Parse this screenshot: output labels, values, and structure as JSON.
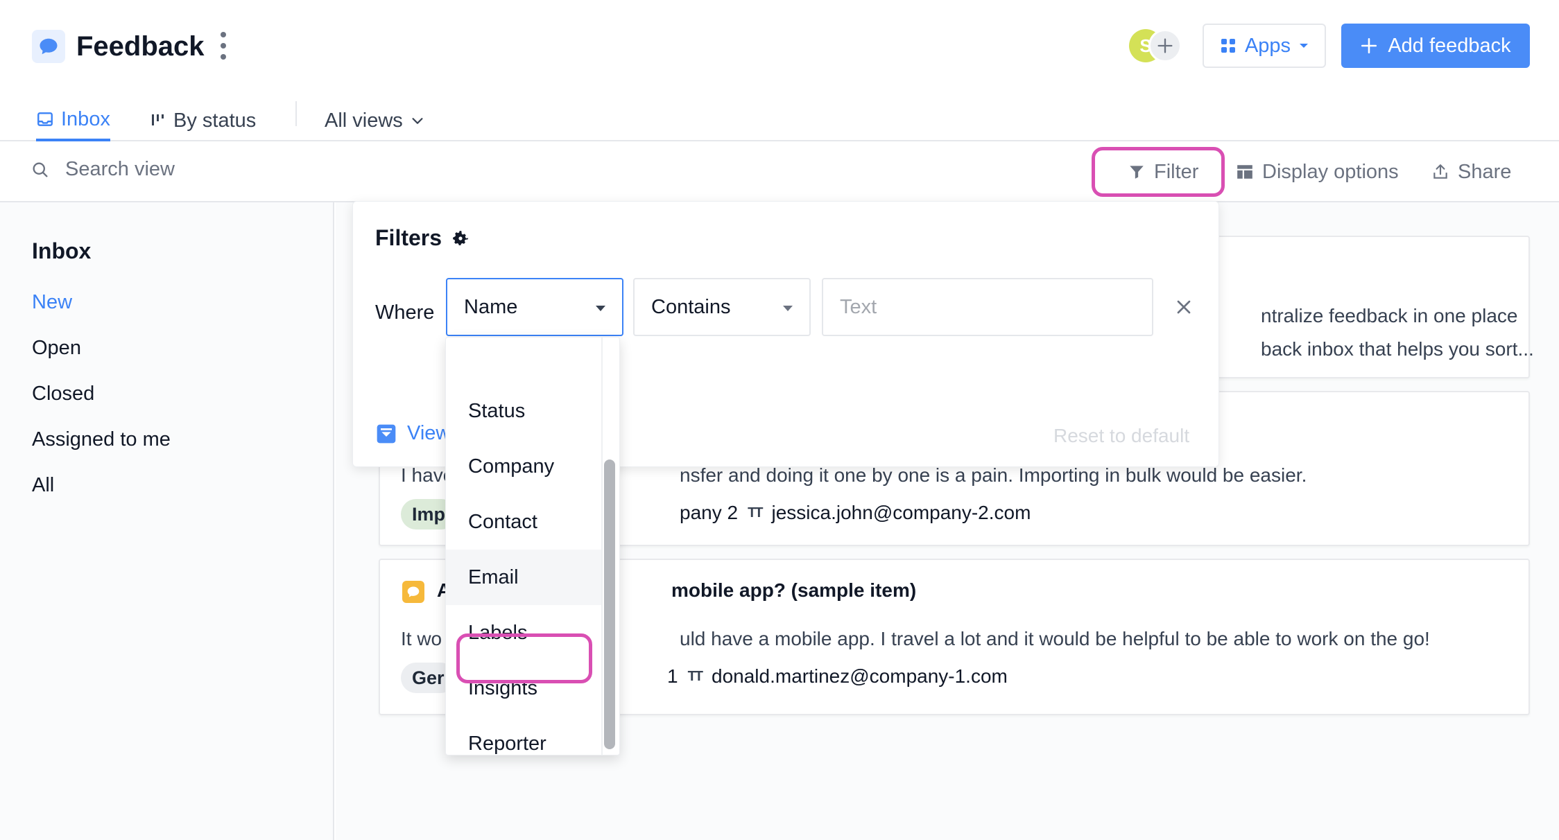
{
  "header": {
    "title": "Feedback",
    "avatar_initial": "S",
    "apps_label": "Apps",
    "add_feedback_label": "Add feedback"
  },
  "tabs": [
    {
      "label": "Inbox"
    },
    {
      "label": "By status"
    },
    {
      "label": "All views"
    }
  ],
  "toolbar": {
    "search_placeholder": "Search view",
    "filter_label": "Filter",
    "display_options_label": "Display options",
    "share_label": "Share"
  },
  "sidebar": {
    "heading": "Inbox",
    "items": [
      {
        "label": "New"
      },
      {
        "label": "Open"
      },
      {
        "label": "Closed"
      },
      {
        "label": "Assigned to me"
      },
      {
        "label": "All"
      }
    ]
  },
  "cards": [
    {
      "line1": "ntralize feedback in one place",
      "line2": "back inbox that helps you sort..."
    },
    {
      "description": "I have",
      "description_rest": "nsfer and doing it one by one is a pain. Importing in bulk would be easier.",
      "chip": "Imp",
      "company": "pany 2",
      "email": "jessica.john@company-2.com"
    },
    {
      "title_prefix": "A",
      "title_rest": "mobile app? (sample item)",
      "description": "It wo",
      "description_rest": "uld have a mobile app. I travel a lot and it would be helpful to be able to work on the go!",
      "chip": "Ger",
      "company": "1",
      "email": "donald.martinez@company-1.com"
    }
  ],
  "filters": {
    "title": "Filters",
    "where_label": "Where",
    "field_value": "Name",
    "operator_value": "Contains",
    "text_placeholder": "Text",
    "view_link": "View",
    "reset_label": "Reset to default"
  },
  "dropdown": {
    "options": [
      "Status",
      "Company",
      "Contact",
      "Email",
      "Labels",
      "Insights",
      "Reporter"
    ]
  },
  "colors": {
    "accent": "#3b82f6",
    "primary_button": "#4a8cf7",
    "highlight": "#d94fb3",
    "chip_green": "#dcebd9",
    "chip_gray": "#eceef1",
    "item_icon_yellow": "#f6b93b",
    "avatar": "#d4e157"
  }
}
